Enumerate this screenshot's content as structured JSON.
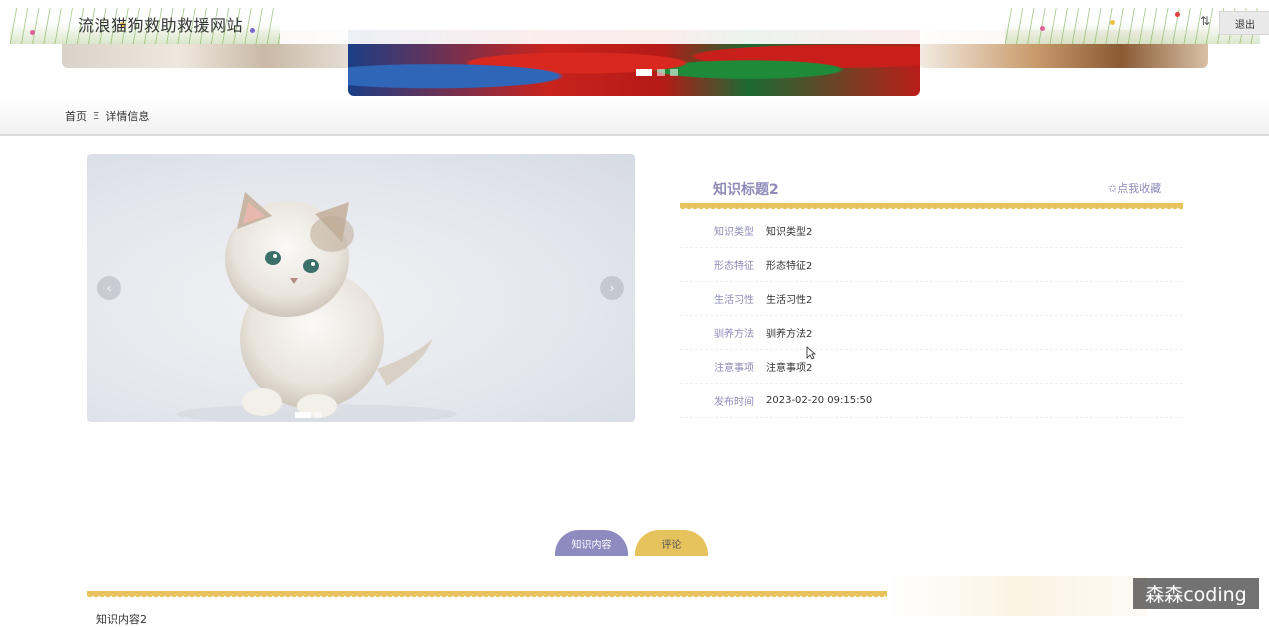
{
  "header": {
    "site_title": "流浪猫狗救助救援网站",
    "logout_label": "退出",
    "user_icon": "user-arrows-icon"
  },
  "breadcrumb": {
    "home": "首页",
    "separator": "Ξ",
    "current": "详情信息"
  },
  "detail": {
    "title": "知识标题2",
    "favorite_label": "✩点我收藏",
    "fields": [
      {
        "label": "知识类型",
        "value": "知识类型2"
      },
      {
        "label": "形态特征",
        "value": "形态特征2"
      },
      {
        "label": "生活习性",
        "value": "生活习性2"
      },
      {
        "label": "驯养方法",
        "value": "驯养方法2"
      },
      {
        "label": "注意事项",
        "value": "注意事项2"
      },
      {
        "label": "发布时间",
        "value": "2023-02-20 09:15:50"
      }
    ]
  },
  "carousel": {
    "prev_glyph": "‹",
    "next_glyph": "›"
  },
  "tabs": {
    "content_label": "知识内容",
    "comment_label": "评论"
  },
  "content": {
    "text": "知识内容2"
  },
  "watermark": "森森coding",
  "colors": {
    "accent_purple": "#8e8bc0",
    "accent_gold": "#e6c35c"
  }
}
